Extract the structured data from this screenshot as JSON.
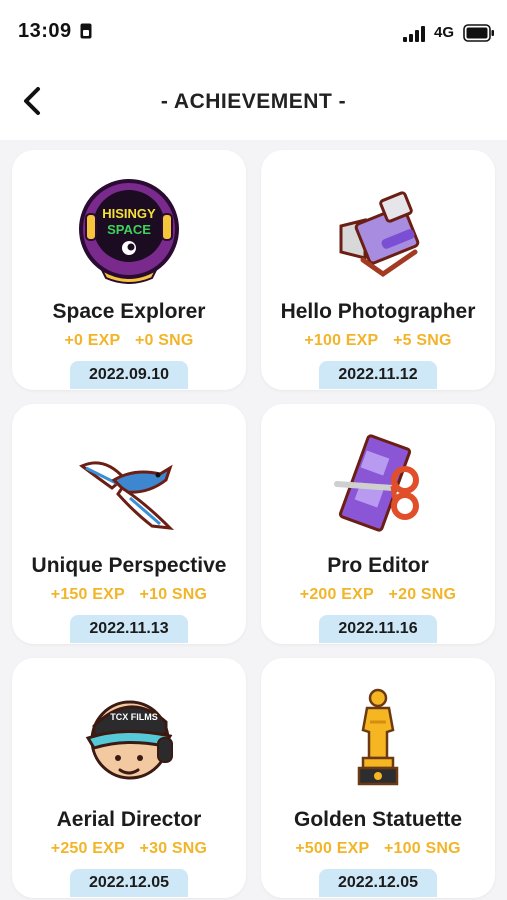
{
  "status_bar": {
    "time": "13:09",
    "network": "4G"
  },
  "header": {
    "title": "- ACHIEVEMENT -"
  },
  "achievements": [
    {
      "name": "Space Explorer",
      "exp": "+0 EXP",
      "sng": "+0 SNG",
      "date": "2022.09.10",
      "icon": "space-helmet-icon",
      "badge_text_1": "HISINGY",
      "badge_text_2": "SPACE"
    },
    {
      "name": "Hello Photographer",
      "exp": "+100 EXP",
      "sng": "+5 SNG",
      "date": "2022.11.12",
      "icon": "video-camera-icon"
    },
    {
      "name": "Unique Perspective",
      "exp": "+150 EXP",
      "sng": "+10 SNG",
      "date": "2022.11.13",
      "icon": "bird-icon"
    },
    {
      "name": "Pro Editor",
      "exp": "+200 EXP",
      "sng": "+20 SNG",
      "date": "2022.11.16",
      "icon": "film-scissors-icon"
    },
    {
      "name": "Aerial Director",
      "exp": "+250 EXP",
      "sng": "+30 SNG",
      "date": "2022.12.05",
      "icon": "director-headset-icon",
      "badge_text_1": "TCX FILMS"
    },
    {
      "name": "Golden Statuette",
      "exp": "+500 EXP",
      "sng": "+100 SNG",
      "date": "2022.12.05",
      "icon": "golden-statuette-icon"
    }
  ],
  "colors": {
    "reward": "#f2b529",
    "date_pill": "#cfe8f7",
    "card": "#ffffff",
    "background": "#f4f4f6"
  }
}
